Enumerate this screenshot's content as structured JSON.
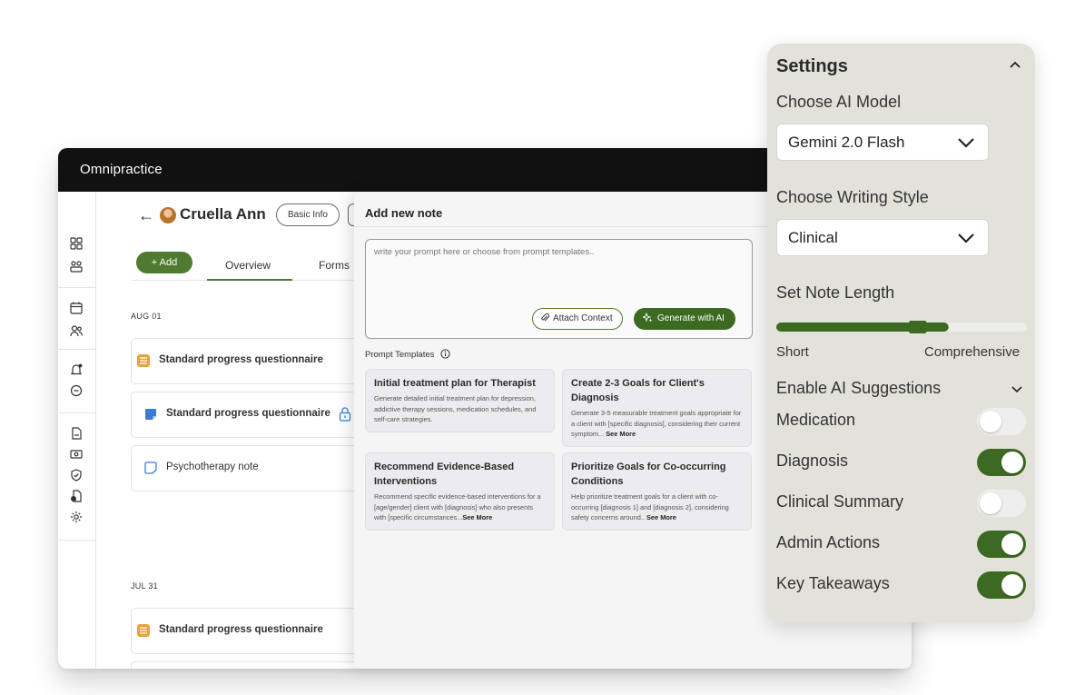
{
  "app": {
    "logo_text": "Omnipractice"
  },
  "patient": {
    "name": "Cruella Ann",
    "basic_info_label": "Basic Info"
  },
  "toolbar": {
    "add_label": "+ Add"
  },
  "tabs": [
    {
      "label": "Overview",
      "active": true
    },
    {
      "label": "Forms",
      "active": false
    }
  ],
  "timeline": {
    "groups": [
      {
        "date": "AUG 01",
        "items": [
          {
            "label": "Standard progress questionnaire",
            "icon": "questionnaire-icon"
          },
          {
            "label": "Standard progress questionnaire",
            "icon": "note-icon",
            "locked": true
          },
          {
            "label": "Psychotherapy note",
            "icon": "note-outline-icon"
          }
        ]
      },
      {
        "date": "JUL 31",
        "items": [
          {
            "label": "Standard progress questionnaire",
            "icon": "questionnaire-icon"
          }
        ]
      }
    ]
  },
  "note_panel": {
    "title": "Add new note",
    "prompt_placeholder": "write your prompt here or choose from prompt templates..",
    "attach_label": "Attach Context",
    "generate_label": "Generate with AI",
    "templates_label": "Prompt Templates",
    "see_more_label": "See More",
    "templates": [
      {
        "title": "Initial treatment plan for Therapist",
        "description": "Generate detailed initial treatment plan for depression, addictive therapy sessions, medication schedules, and self-care strategies.",
        "see_more": false
      },
      {
        "title": "Create 2-3 Goals for Client's Diagnosis",
        "description": "Generate 3-5 measurable treatment goals appropriate for a client with [specific diagnosis], considering their current symptom...",
        "see_more": true
      },
      {
        "title": "Recommend Evidence-Based Interventions",
        "description": "Recommend specific evidence-based interventions for a [age/gender] client with [diagnosis] who also presents with [specific circumstances...",
        "see_more": true
      },
      {
        "title": "Prioritize Goals for Co-occurring Conditions",
        "description": "Help prioritize treatment goals for a client with co-occurring [diagnosis 1] and [diagnosis 2], considering safety concerns around..",
        "see_more": true
      }
    ]
  },
  "settings": {
    "title": "Settings",
    "model_label": "Choose AI Model",
    "model_value": "Gemini 2.0 Flash",
    "style_label": "Choose Writing Style",
    "style_value": "Clinical",
    "length_label": "Set Note Length",
    "length_value": 0.57,
    "length_min_label": "Short",
    "length_max_label": "Comprehensive",
    "suggestions_label": "Enable AI Suggestions",
    "toggles": [
      {
        "label": "Medication",
        "on": false
      },
      {
        "label": "Diagnosis",
        "on": true
      },
      {
        "label": "Clinical Summary",
        "on": false
      },
      {
        "label": "Admin Actions",
        "on": true
      },
      {
        "label": "Key Takeaways",
        "on": true
      }
    ]
  },
  "colors": {
    "accent": "#3d6a22",
    "accent_light": "#4f7a2f",
    "settings_bg": "#e3e2da",
    "topbar": "#111111"
  }
}
